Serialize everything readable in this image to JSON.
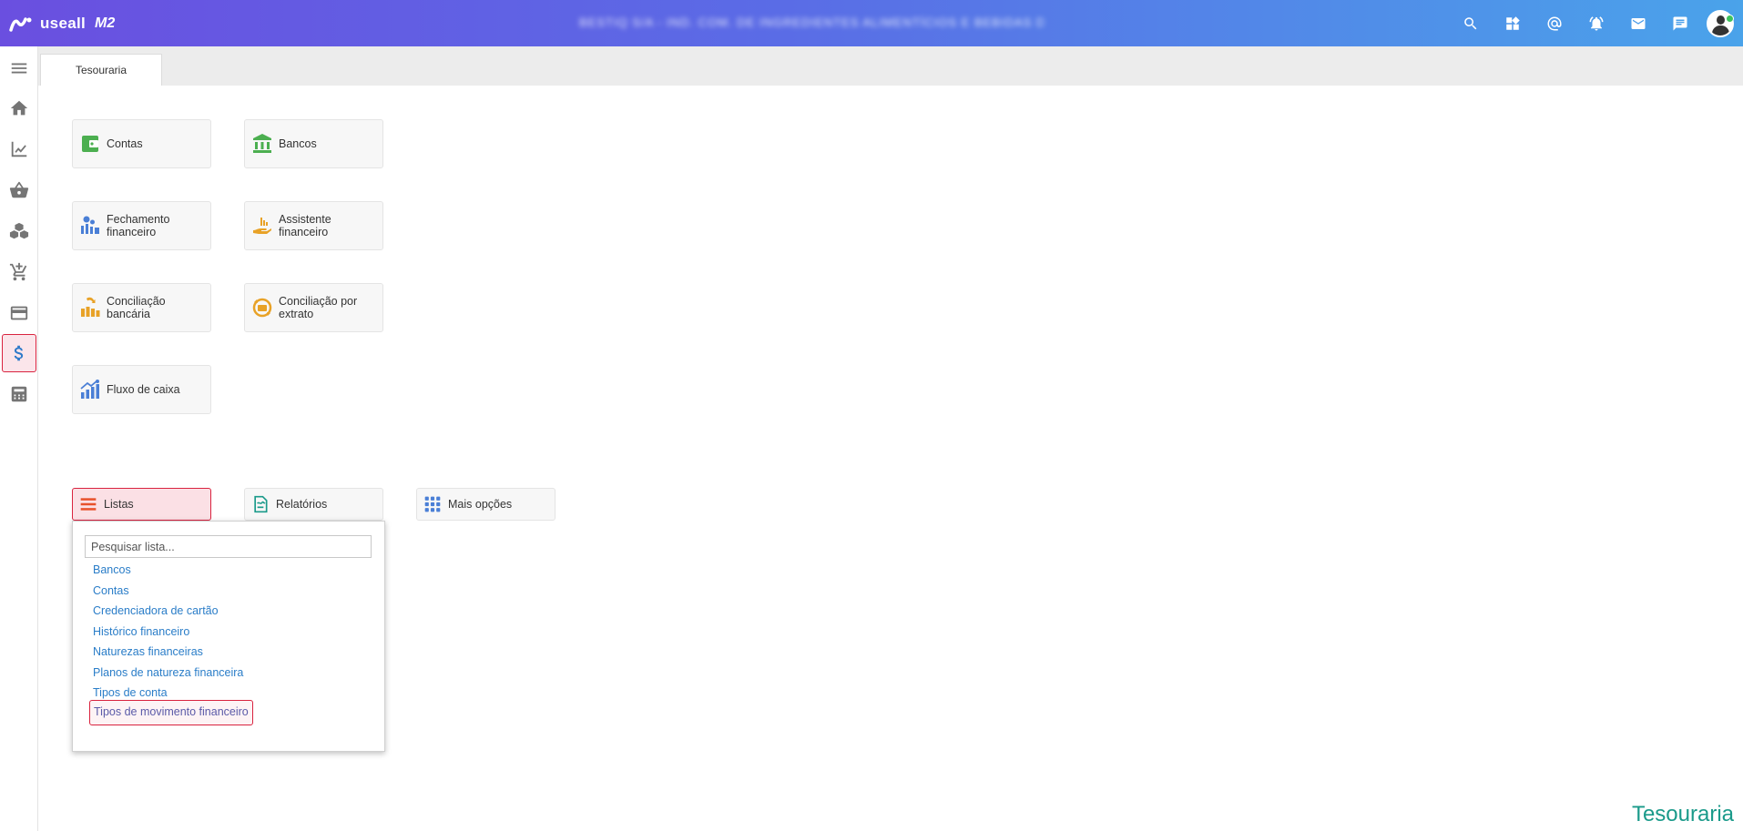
{
  "header": {
    "brand": "useall",
    "version": "M2",
    "company": "BESTIQ S/A - IND. COM. DE INGREDIENTES ALIMENTÍCIOS E BEBIDAS DA LTDA",
    "icons": [
      "search-icon",
      "widgets-icon",
      "at-icon",
      "alarm-icon",
      "mail-icon",
      "chat-icon",
      "user-avatar"
    ]
  },
  "sidebar": {
    "items": [
      "menu-icon",
      "home-icon",
      "chart-icon",
      "basket-icon",
      "boxes-icon",
      "cart-icon",
      "card-icon",
      "dollar-icon",
      "calculator-icon"
    ],
    "active": "dollar-icon"
  },
  "tabs": [
    {
      "label": "Tesouraria"
    }
  ],
  "tiles": [
    {
      "label": "Contas",
      "icon": "wallet-icon"
    },
    {
      "label": "Bancos",
      "icon": "bank-icon"
    },
    {
      "label": "Fechamento financeiro",
      "icon": "closing-icon"
    },
    {
      "label": "Assistente financeiro",
      "icon": "assistant-icon"
    },
    {
      "label": "Conciliação bancária",
      "icon": "reconcile-icon"
    },
    {
      "label": "Conciliação por extrato",
      "icon": "statement-icon"
    },
    {
      "label": "Fluxo de caixa",
      "icon": "cashflow-icon"
    }
  ],
  "options": [
    {
      "label": "Listas",
      "icon": "list-icon"
    },
    {
      "label": "Relatórios",
      "icon": "report-icon"
    },
    {
      "label": "Mais opções",
      "icon": "grid-icon"
    }
  ],
  "dropdown": {
    "placeholder": "Pesquisar lista...",
    "items": [
      {
        "label": "Bancos"
      },
      {
        "label": "Contas"
      },
      {
        "label": "Credenciadora de cartão"
      },
      {
        "label": "Histórico financeiro"
      },
      {
        "label": "Naturezas financeiras"
      },
      {
        "label": "Planos de natureza financeira"
      },
      {
        "label": "Tipos de conta"
      },
      {
        "label": "Tipos de movimento financeiro"
      }
    ],
    "highlighted": "Tipos de movimento financeiro"
  },
  "watermark": "Tesouraria",
  "colors": {
    "accent": "#2a7dc8",
    "highlight": "#d9233f",
    "brand_start": "#6a4fe0",
    "brand_end": "#4aa3ea",
    "watermark": "#1a9a8a"
  }
}
